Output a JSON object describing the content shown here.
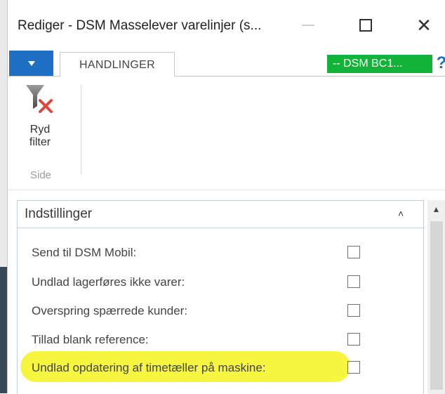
{
  "window": {
    "title": "Rediger - DSM Masselever varelinjer (s..."
  },
  "ribbon": {
    "tab_label": "HANDLINGER",
    "company": "-- DSM BC1...",
    "help_glyph": "?",
    "action_ryd_line1": "Ryd",
    "action_ryd_line2": "filter",
    "group_label": "Side",
    "icons": {
      "app_menu": "dropdown-triangle-icon",
      "ryd_filter": "clear-filter-icon",
      "help": "help-icon"
    }
  },
  "panel": {
    "title": "Indstillinger",
    "collapse_glyph": "˄",
    "fields": [
      {
        "label": "Send til DSM Mobil:",
        "checked": false
      },
      {
        "label": "Undlad lagerføres ikke varer:",
        "checked": false
      },
      {
        "label": "Overspring spærrede kunder:",
        "checked": false
      },
      {
        "label": "Tillad blank reference:",
        "checked": false
      },
      {
        "label": "Undlad opdatering af timetæller på maskine:",
        "checked": false,
        "highlighted": true
      }
    ]
  },
  "colors": {
    "app_menu": "#1f6fc5",
    "company_badge": "#13b339",
    "highlight": "#f5f536",
    "panel_border": "#bfcfe0"
  }
}
